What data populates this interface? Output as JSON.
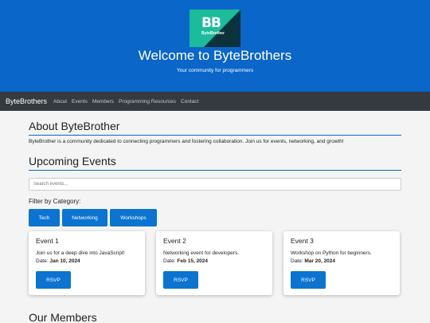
{
  "hero": {
    "logo_letters": "BB",
    "logo_word": "ByteBrother",
    "title": "Welcome to ByteBrothers",
    "subtitle": "Your community for programmers"
  },
  "nav": {
    "brand": "ByteBrothers",
    "links": [
      "About",
      "Events",
      "Members",
      "Programming Resources",
      "Contact"
    ]
  },
  "about": {
    "title": "About ByteBrother",
    "text": "ByteBrother is a community dedicated to connecting programmers and fostering collaboration. Join us for events, networking, and growth!"
  },
  "events": {
    "title": "Upcoming Events",
    "search_placeholder": "Search events...",
    "filter_label": "Filter by Category:",
    "categories": [
      "Tech",
      "Networking",
      "Workshops"
    ],
    "date_label": "Date:",
    "rsvp_label": "RSVP",
    "cards": [
      {
        "title": "Event 1",
        "desc": "Join us for a deep dive into JavaScript!",
        "date": "Jan 10, 2024"
      },
      {
        "title": "Event 2",
        "desc": "Networking event for developers.",
        "date": "Feb 15, 2024"
      },
      {
        "title": "Event 3",
        "desc": "Workshop on Python for beginners.",
        "date": "Mar 20, 2024"
      }
    ]
  },
  "members": {
    "title": "Our Members"
  },
  "colors": {
    "primary": "#0a66c9",
    "button": "#0a74d0",
    "nav_bg": "#343a40",
    "logo_bg": "#1abc9c"
  }
}
